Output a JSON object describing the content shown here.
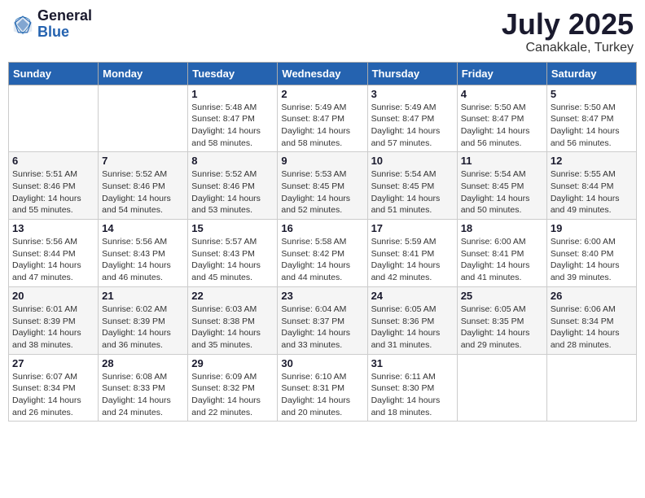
{
  "header": {
    "logo_general": "General",
    "logo_blue": "Blue",
    "month_title": "July 2025",
    "subtitle": "Canakkale, Turkey"
  },
  "days_of_week": [
    "Sunday",
    "Monday",
    "Tuesday",
    "Wednesday",
    "Thursday",
    "Friday",
    "Saturday"
  ],
  "weeks": [
    [
      {
        "day": "",
        "sunrise": "",
        "sunset": "",
        "daylight": ""
      },
      {
        "day": "",
        "sunrise": "",
        "sunset": "",
        "daylight": ""
      },
      {
        "day": "1",
        "sunrise": "Sunrise: 5:48 AM",
        "sunset": "Sunset: 8:47 PM",
        "daylight": "Daylight: 14 hours and 58 minutes."
      },
      {
        "day": "2",
        "sunrise": "Sunrise: 5:49 AM",
        "sunset": "Sunset: 8:47 PM",
        "daylight": "Daylight: 14 hours and 58 minutes."
      },
      {
        "day": "3",
        "sunrise": "Sunrise: 5:49 AM",
        "sunset": "Sunset: 8:47 PM",
        "daylight": "Daylight: 14 hours and 57 minutes."
      },
      {
        "day": "4",
        "sunrise": "Sunrise: 5:50 AM",
        "sunset": "Sunset: 8:47 PM",
        "daylight": "Daylight: 14 hours and 56 minutes."
      },
      {
        "day": "5",
        "sunrise": "Sunrise: 5:50 AM",
        "sunset": "Sunset: 8:47 PM",
        "daylight": "Daylight: 14 hours and 56 minutes."
      }
    ],
    [
      {
        "day": "6",
        "sunrise": "Sunrise: 5:51 AM",
        "sunset": "Sunset: 8:46 PM",
        "daylight": "Daylight: 14 hours and 55 minutes."
      },
      {
        "day": "7",
        "sunrise": "Sunrise: 5:52 AM",
        "sunset": "Sunset: 8:46 PM",
        "daylight": "Daylight: 14 hours and 54 minutes."
      },
      {
        "day": "8",
        "sunrise": "Sunrise: 5:52 AM",
        "sunset": "Sunset: 8:46 PM",
        "daylight": "Daylight: 14 hours and 53 minutes."
      },
      {
        "day": "9",
        "sunrise": "Sunrise: 5:53 AM",
        "sunset": "Sunset: 8:45 PM",
        "daylight": "Daylight: 14 hours and 52 minutes."
      },
      {
        "day": "10",
        "sunrise": "Sunrise: 5:54 AM",
        "sunset": "Sunset: 8:45 PM",
        "daylight": "Daylight: 14 hours and 51 minutes."
      },
      {
        "day": "11",
        "sunrise": "Sunrise: 5:54 AM",
        "sunset": "Sunset: 8:45 PM",
        "daylight": "Daylight: 14 hours and 50 minutes."
      },
      {
        "day": "12",
        "sunrise": "Sunrise: 5:55 AM",
        "sunset": "Sunset: 8:44 PM",
        "daylight": "Daylight: 14 hours and 49 minutes."
      }
    ],
    [
      {
        "day": "13",
        "sunrise": "Sunrise: 5:56 AM",
        "sunset": "Sunset: 8:44 PM",
        "daylight": "Daylight: 14 hours and 47 minutes."
      },
      {
        "day": "14",
        "sunrise": "Sunrise: 5:56 AM",
        "sunset": "Sunset: 8:43 PM",
        "daylight": "Daylight: 14 hours and 46 minutes."
      },
      {
        "day": "15",
        "sunrise": "Sunrise: 5:57 AM",
        "sunset": "Sunset: 8:43 PM",
        "daylight": "Daylight: 14 hours and 45 minutes."
      },
      {
        "day": "16",
        "sunrise": "Sunrise: 5:58 AM",
        "sunset": "Sunset: 8:42 PM",
        "daylight": "Daylight: 14 hours and 44 minutes."
      },
      {
        "day": "17",
        "sunrise": "Sunrise: 5:59 AM",
        "sunset": "Sunset: 8:41 PM",
        "daylight": "Daylight: 14 hours and 42 minutes."
      },
      {
        "day": "18",
        "sunrise": "Sunrise: 6:00 AM",
        "sunset": "Sunset: 8:41 PM",
        "daylight": "Daylight: 14 hours and 41 minutes."
      },
      {
        "day": "19",
        "sunrise": "Sunrise: 6:00 AM",
        "sunset": "Sunset: 8:40 PM",
        "daylight": "Daylight: 14 hours and 39 minutes."
      }
    ],
    [
      {
        "day": "20",
        "sunrise": "Sunrise: 6:01 AM",
        "sunset": "Sunset: 8:39 PM",
        "daylight": "Daylight: 14 hours and 38 minutes."
      },
      {
        "day": "21",
        "sunrise": "Sunrise: 6:02 AM",
        "sunset": "Sunset: 8:39 PM",
        "daylight": "Daylight: 14 hours and 36 minutes."
      },
      {
        "day": "22",
        "sunrise": "Sunrise: 6:03 AM",
        "sunset": "Sunset: 8:38 PM",
        "daylight": "Daylight: 14 hours and 35 minutes."
      },
      {
        "day": "23",
        "sunrise": "Sunrise: 6:04 AM",
        "sunset": "Sunset: 8:37 PM",
        "daylight": "Daylight: 14 hours and 33 minutes."
      },
      {
        "day": "24",
        "sunrise": "Sunrise: 6:05 AM",
        "sunset": "Sunset: 8:36 PM",
        "daylight": "Daylight: 14 hours and 31 minutes."
      },
      {
        "day": "25",
        "sunrise": "Sunrise: 6:05 AM",
        "sunset": "Sunset: 8:35 PM",
        "daylight": "Daylight: 14 hours and 29 minutes."
      },
      {
        "day": "26",
        "sunrise": "Sunrise: 6:06 AM",
        "sunset": "Sunset: 8:34 PM",
        "daylight": "Daylight: 14 hours and 28 minutes."
      }
    ],
    [
      {
        "day": "27",
        "sunrise": "Sunrise: 6:07 AM",
        "sunset": "Sunset: 8:34 PM",
        "daylight": "Daylight: 14 hours and 26 minutes."
      },
      {
        "day": "28",
        "sunrise": "Sunrise: 6:08 AM",
        "sunset": "Sunset: 8:33 PM",
        "daylight": "Daylight: 14 hours and 24 minutes."
      },
      {
        "day": "29",
        "sunrise": "Sunrise: 6:09 AM",
        "sunset": "Sunset: 8:32 PM",
        "daylight": "Daylight: 14 hours and 22 minutes."
      },
      {
        "day": "30",
        "sunrise": "Sunrise: 6:10 AM",
        "sunset": "Sunset: 8:31 PM",
        "daylight": "Daylight: 14 hours and 20 minutes."
      },
      {
        "day": "31",
        "sunrise": "Sunrise: 6:11 AM",
        "sunset": "Sunset: 8:30 PM",
        "daylight": "Daylight: 14 hours and 18 minutes."
      },
      {
        "day": "",
        "sunrise": "",
        "sunset": "",
        "daylight": ""
      },
      {
        "day": "",
        "sunrise": "",
        "sunset": "",
        "daylight": ""
      }
    ]
  ]
}
